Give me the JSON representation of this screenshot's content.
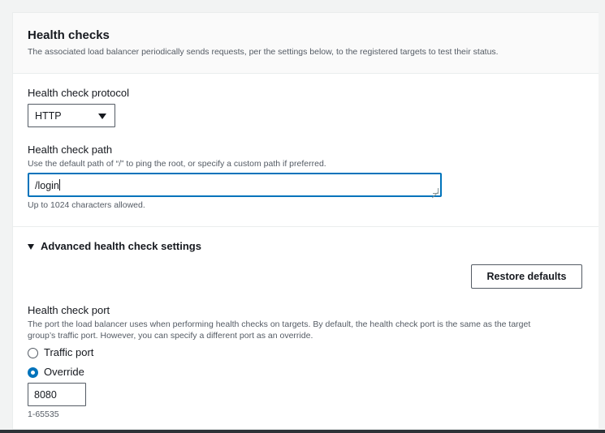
{
  "section": {
    "title": "Health checks",
    "description": "The associated load balancer periodically sends requests, per the settings below, to the registered targets to test their status."
  },
  "protocol": {
    "label": "Health check protocol",
    "value": "HTTP"
  },
  "path": {
    "label": "Health check path",
    "description": "Use the default path of “/” to ping the root, or specify a custom path if preferred.",
    "value": "/login",
    "constraint": "Up to 1024 characters allowed."
  },
  "advanced": {
    "label": "Advanced health check settings",
    "expanded": true,
    "restore_label": "Restore defaults"
  },
  "port": {
    "label": "Health check port",
    "description_line1": "The port the load balancer uses when performing health checks on targets. By default, the health check port is the same as the target",
    "description_line2": "group’s traffic port. However, you can specify a different port as an override.",
    "options": [
      {
        "label": "Traffic port",
        "selected": false
      },
      {
        "label": "Override",
        "selected": true
      }
    ],
    "value": "8080",
    "constraint": "1-65535"
  },
  "colors": {
    "accent": "#0073bb",
    "text": "#16191f",
    "muted": "#545b64"
  }
}
